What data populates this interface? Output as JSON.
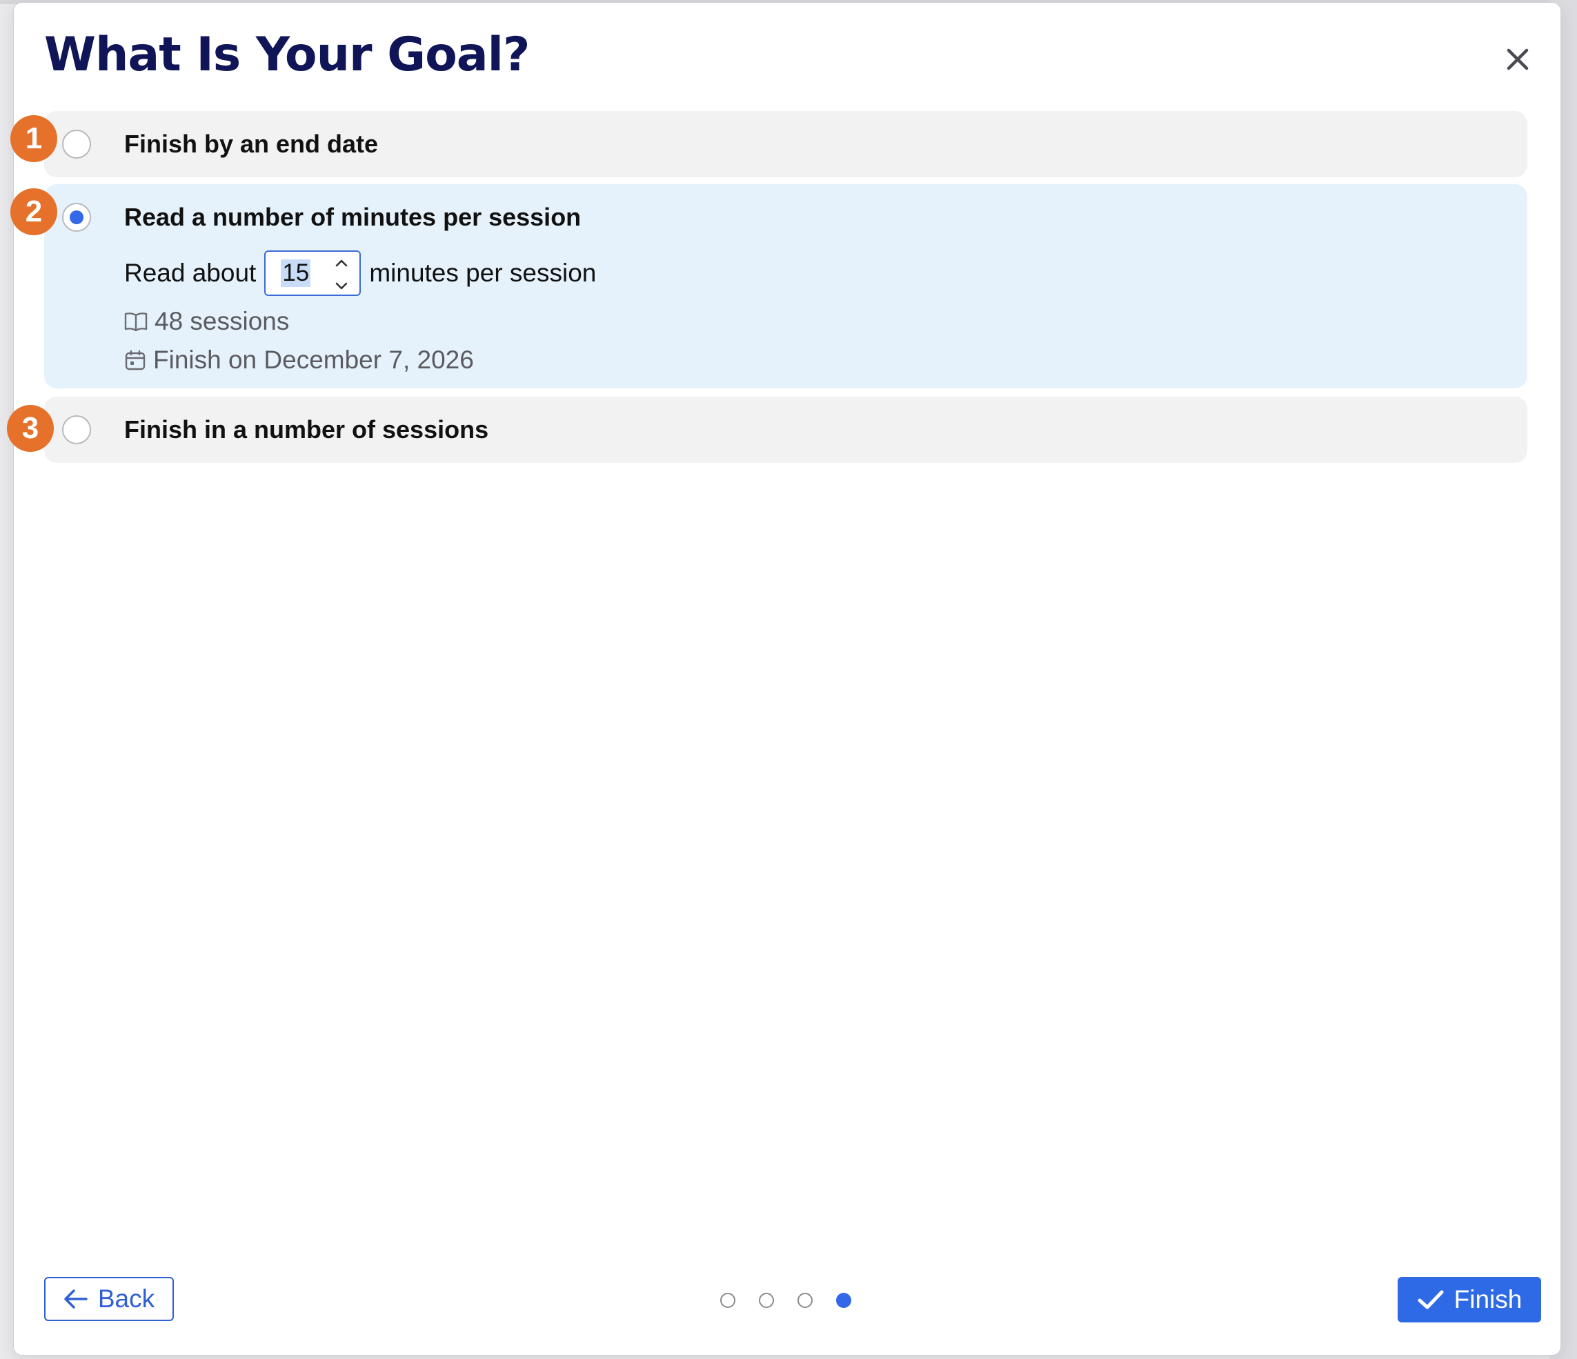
{
  "dialog": {
    "title": "What Is Your Goal?",
    "close_icon": "close-icon"
  },
  "options": [
    {
      "badge": "1",
      "label": "Finish by an end date",
      "selected": false
    },
    {
      "badge": "2",
      "label": "Read a number of minutes per session",
      "selected": true,
      "details": {
        "prefix": "Read about",
        "minutes_value": "15",
        "suffix": "minutes per session",
        "sessions_text": "48 sessions",
        "sessions_icon": "book-icon",
        "finish_text": "Finish on December 7, 2026",
        "finish_icon": "calendar-icon"
      }
    },
    {
      "badge": "3",
      "label": "Finish in a number of sessions",
      "selected": false
    }
  ],
  "footer": {
    "back_label": "Back",
    "back_icon": "arrow-left-icon",
    "finish_label": "Finish",
    "finish_icon": "check-icon",
    "pager": {
      "total": 4,
      "current": 4
    }
  },
  "colors": {
    "title": "#0f1557",
    "accent": "#2f6ae6",
    "badge": "#e5712a",
    "selected_bg": "#e5f2fc",
    "option_bg": "#f2f2f2"
  }
}
